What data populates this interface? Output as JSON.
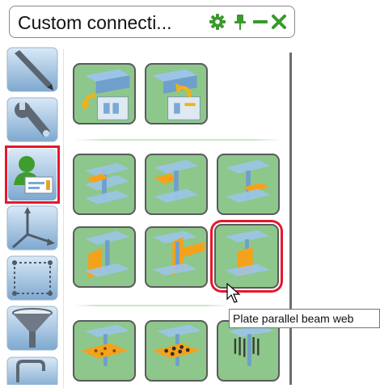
{
  "title": {
    "text": "Custom connecti...",
    "icons": [
      "gear-icon",
      "pin-icon",
      "minimize-icon",
      "close-icon"
    ]
  },
  "toolbar": {
    "items": [
      "pencil-icon",
      "wrench-icon",
      "user-component-icon",
      "axes-icon",
      "dotted-box-icon",
      "funnel-icon",
      "clamp-icon"
    ],
    "selected": "user-component-icon"
  },
  "catalog": {
    "rows": [
      [
        "beam-rotate-left-icon",
        "beam-rotate-right-icon"
      ],
      [
        "plate-on-lower-flange-icon",
        "plate-on-upper-flange-icon",
        "plate-in-web-icon"
      ],
      [
        "plate-left-of-web-icon",
        "plate-through-web-icon",
        "plate-parallel-beam-web-icon"
      ],
      [
        "perforated-plate-icon",
        "bolted-plate-icon",
        "stud-anchors-icon"
      ]
    ],
    "selected": "plate-parallel-beam-web-icon"
  },
  "tooltip": {
    "text": "Plate parallel beam web"
  },
  "colors": {
    "tile": "#8dc78c",
    "selection": "#e5172c",
    "beam": "#79a9d4",
    "plate": "#f4a21c"
  }
}
